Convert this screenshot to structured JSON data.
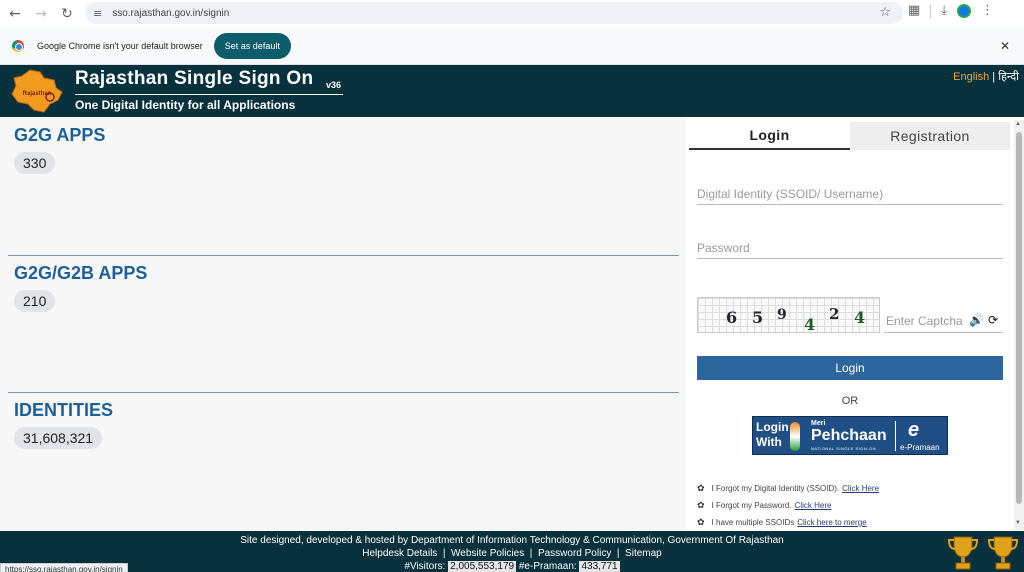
{
  "browser": {
    "url": "sso.rajasthan.gov.in/signin",
    "infobar_message": "Google Chrome isn't your default browser",
    "set_default_label": "Set as default",
    "status_url": "https://sso.rajasthan.gov.in/signin"
  },
  "header": {
    "title": "Rajasthan Single Sign On",
    "version": "v36",
    "subtitle": "One Digital Identity for all Applications",
    "lang_english": "English",
    "lang_separator": " | ",
    "lang_hindi": "हिन्दी",
    "logo_text": "Rajasthan"
  },
  "stats": [
    {
      "title": "G2G APPS",
      "count": "330"
    },
    {
      "title": "G2G/G2B APPS",
      "count": "210"
    },
    {
      "title": "IDENTITIES",
      "count": "31,608,321"
    }
  ],
  "login": {
    "tab_login": "Login",
    "tab_registration": "Registration",
    "ssoid_placeholder": "Digital Identity (SSOID/ Username)",
    "password_placeholder": "Password",
    "captcha_digits": [
      "6",
      "5",
      "9",
      "4",
      "2",
      "4"
    ],
    "captcha_placeholder": "Enter Captcha",
    "login_button": "Login",
    "or_text": "OR",
    "pehchaan": {
      "login_with_line1": "Login",
      "login_with_line2": "With",
      "meri": "Meri",
      "name": "Pehchaan",
      "sub": "NATIONAL SINGLE SIGN-ON",
      "epramaan": "e-Pramaan",
      "e": "e"
    },
    "links": [
      {
        "text": "I Forgot my Digital Identity (SSOID).",
        "link": "Click Here"
      },
      {
        "text": "I Forgot my Password.",
        "link": "Click Here"
      },
      {
        "text": "I have multiple SSOIDs",
        "link": "Click here to merge"
      }
    ]
  },
  "footer": {
    "line1": "Site designed, developed & hosted by Department of Information Technology & Communication, Government Of Rajasthan",
    "helpdesk": "Helpdesk Details",
    "policies": "Website Policies",
    "password_policy": "Password Policy",
    "sitemap": "Sitemap",
    "visitors_label": "#Visitors:",
    "visitors": "2,005,553,179",
    "epramaan_label": "#e-Pramaan:",
    "epramaan": "433,771",
    "sep": "|"
  },
  "colors": {
    "header_bg": "#07313d",
    "accent_blue": "#1d5f98",
    "login_button": "#2d669e",
    "lang_english": "#f2a33a"
  },
  "icons": [
    "back-icon",
    "forward-icon",
    "reload-icon",
    "site-settings-icon",
    "bookmark-star-icon",
    "extensions-icon",
    "download-icon",
    "profile-icon",
    "menu-icon",
    "close-icon",
    "speaker-icon",
    "refresh-icon",
    "trophy-icon"
  ]
}
